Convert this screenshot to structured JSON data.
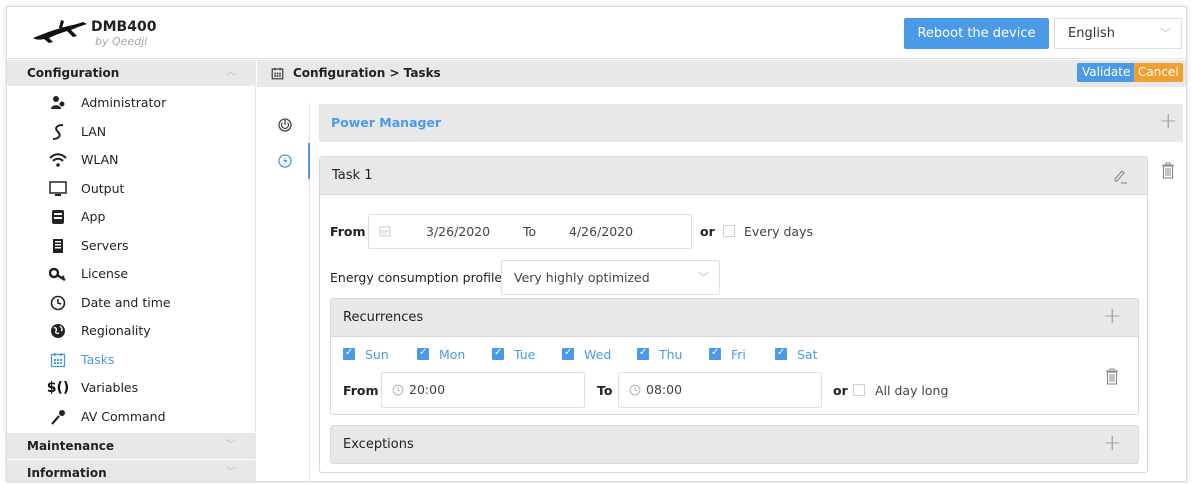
{
  "header": {
    "app_name": "DMB400",
    "app_sub": "by Qeedji",
    "reboot_label": "Reboot the device",
    "language": "English"
  },
  "sidebar": {
    "configuration_label": "Configuration",
    "items": [
      {
        "label": "Administrator",
        "icon": "administrator-icon"
      },
      {
        "label": "LAN",
        "icon": "lan-icon"
      },
      {
        "label": "WLAN",
        "icon": "wifi-icon"
      },
      {
        "label": "Output",
        "icon": "monitor-icon"
      },
      {
        "label": "App",
        "icon": "app-icon"
      },
      {
        "label": "Servers",
        "icon": "server-icon"
      },
      {
        "label": "License",
        "icon": "key-icon"
      },
      {
        "label": "Date and time",
        "icon": "clock-icon"
      },
      {
        "label": "Regionality",
        "icon": "globe-icon"
      },
      {
        "label": "Tasks",
        "icon": "calendar-icon",
        "active": true
      },
      {
        "label": "Variables",
        "icon": "variables-icon"
      },
      {
        "label": "AV Command",
        "icon": "microphone-icon"
      }
    ],
    "maintenance_label": "Maintenance",
    "information_label": "Information"
  },
  "main": {
    "breadcrumb": "Configuration > Tasks",
    "validate_label": "Validate",
    "cancel_label": "Cancel",
    "section_title": "Power Manager",
    "task": {
      "title": "Task 1",
      "from_label": "From",
      "from_date": "3/26/2020",
      "to_label": "To",
      "to_date": "4/26/2020",
      "or_label": "or",
      "every_days_label": "Every days",
      "energy_label": "Energy consumption profile",
      "energy_value": "Very highly optimized",
      "recurrences": {
        "title": "Recurrences",
        "days": [
          {
            "label": "Sun",
            "checked": true
          },
          {
            "label": "Mon",
            "checked": true
          },
          {
            "label": "Tue",
            "checked": true
          },
          {
            "label": "Wed",
            "checked": true
          },
          {
            "label": "Thu",
            "checked": true
          },
          {
            "label": "Fri",
            "checked": true
          },
          {
            "label": "Sat",
            "checked": true
          }
        ],
        "from_label": "From",
        "from_time": "20:00",
        "to_label": "To",
        "to_time": "08:00",
        "or_label": "or",
        "all_day_label": "All day long"
      },
      "exceptions_title": "Exceptions"
    }
  },
  "colors": {
    "accent": "#4a9ae8",
    "cancel": "#f0a030",
    "panel_gray": "#e8e8e8"
  }
}
